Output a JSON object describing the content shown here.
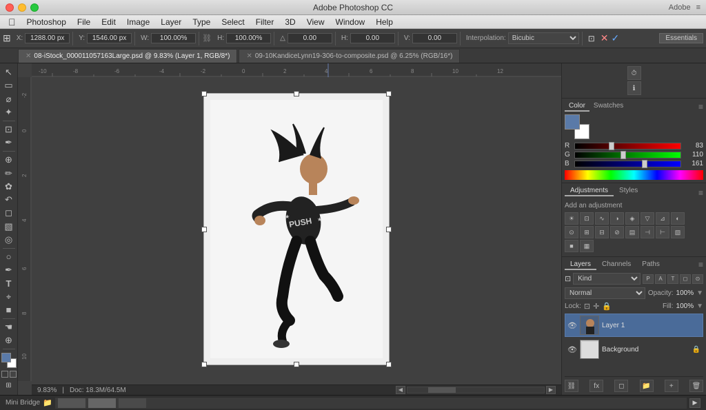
{
  "titlebar": {
    "title": "Adobe Photoshop CC",
    "adobe_label": "Adobe"
  },
  "menubar": {
    "apple": "&#63743;",
    "items": [
      "Photoshop",
      "File",
      "Edit",
      "Image",
      "Layer",
      "Type",
      "Select",
      "Filter",
      "3D",
      "View",
      "Window",
      "Help"
    ]
  },
  "optionsbar": {
    "x_label": "X:",
    "x_value": "1288.00 px",
    "y_label": "Y:",
    "y_value": "1546.00 px",
    "w_label": "W:",
    "w_value": "100.00%",
    "h_label": "H:",
    "h_value": "100.00%",
    "rotate_label": "&#9651;",
    "rotate_value": "0.00",
    "skew_h_label": "H:",
    "skew_h_value": "0.00",
    "skew_v_label": "V:",
    "skew_v_value": "0.00",
    "interpolation_label": "Interpolation:",
    "interpolation_value": "Bicubic",
    "essentials": "Essentials"
  },
  "tabs": {
    "tab1": "08-iStock_000011057163Large.psd @ 9.83% (Layer 1, RGB/8*)",
    "tab2": "09-10KandiceLynn19-306-to-composite.psd @ 6.25% (RGB/16*)"
  },
  "canvas": {
    "zoom": "9.83%",
    "doc_size": "Doc: 18.3M/64.5M"
  },
  "color_panel": {
    "title": "Color",
    "swatches_tab": "Swatches",
    "r_value": "83",
    "g_value": "110",
    "b_value": "161"
  },
  "adjustments_panel": {
    "title": "Adjustments",
    "styles_tab": "Styles",
    "label": "Add an adjustment"
  },
  "layers_panel": {
    "layers_tab": "Layers",
    "channels_tab": "Channels",
    "paths_tab": "Paths",
    "filter_label": "Kind",
    "blend_mode": "Normal",
    "opacity_label": "Opacity:",
    "opacity_value": "100%",
    "fill_label": "Fill:",
    "fill_value": "100%",
    "lock_label": "Lock:",
    "layer1_name": "Layer 1",
    "background_name": "Background",
    "fx_btn": "fx"
  },
  "tools": [
    "M",
    "L",
    "W",
    "C",
    "E",
    "P",
    "T",
    "G",
    "H",
    "Z",
    "I",
    "B",
    "S",
    "R",
    "D",
    "Q",
    "K",
    "N",
    "V",
    "F",
    "A"
  ],
  "status": {
    "zoom": "9.83%",
    "doc_info": "Doc: 18.3M/64.5M"
  }
}
